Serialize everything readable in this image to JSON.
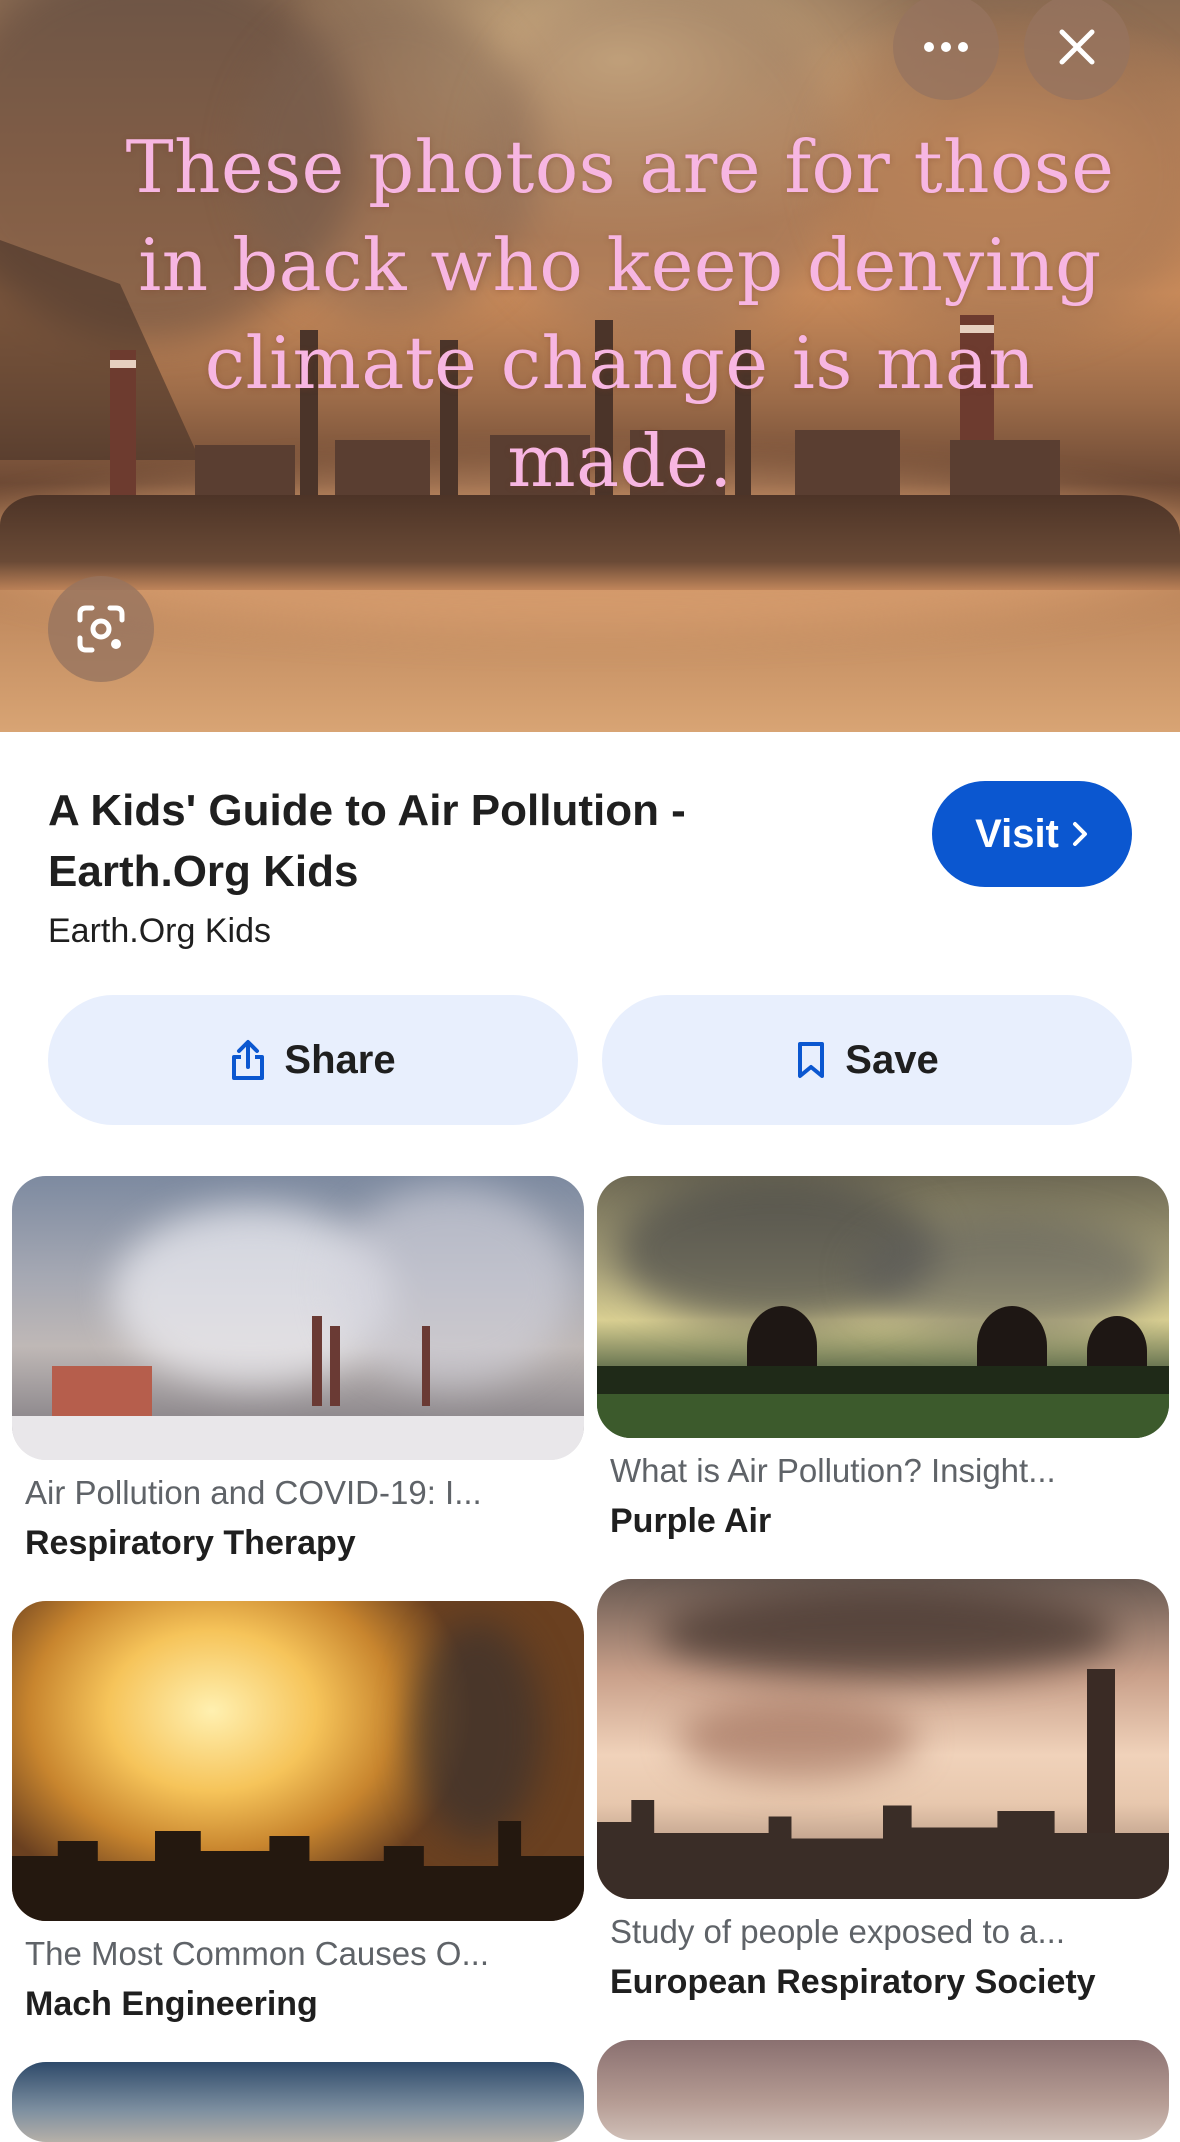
{
  "hero": {
    "quote": "These photos are for those in back who keep denying climate change is man made.",
    "more_icon": "more-horizontal-icon",
    "close_icon": "close-icon",
    "lens_icon": "google-lens-icon"
  },
  "result": {
    "title": "A Kids' Guide to Air Pollution - Earth.Org Kids",
    "source": "Earth.Org Kids",
    "visit_label": "Visit",
    "share_label": "Share",
    "save_label": "Save"
  },
  "related": [
    {
      "title": "Air Pollution and COVID-19: I...",
      "source": "Respiratory Therapy"
    },
    {
      "title": "What is Air Pollution? Insight...",
      "source": "Purple Air"
    },
    {
      "title": "The Most Common Causes O...",
      "source": "Mach Engineering"
    },
    {
      "title": "Study of people exposed to a...",
      "source": "European Respiratory Society"
    }
  ],
  "colors": {
    "accent": "#0b57d0",
    "pill_bg": "#e8effd",
    "quote_text": "#f7b6e2"
  }
}
